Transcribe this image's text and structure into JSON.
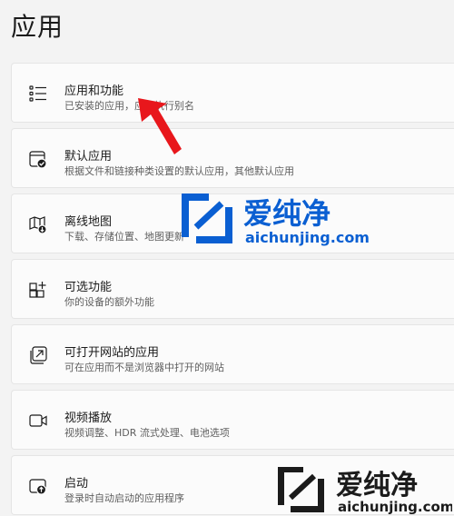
{
  "page": {
    "title": "应用"
  },
  "items": [
    {
      "title": "应用和功能",
      "desc": "已安装的应用，应用执行别名",
      "icon": "apps-list-icon"
    },
    {
      "title": "默认应用",
      "desc": "根据文件和链接种类设置的默认应用，其他默认应用",
      "icon": "default-apps-icon"
    },
    {
      "title": "离线地图",
      "desc": "下载、存储位置、地图更新",
      "icon": "offline-maps-icon"
    },
    {
      "title": "可选功能",
      "desc": "你的设备的额外功能",
      "icon": "optional-features-icon"
    },
    {
      "title": "可打开网站的应用",
      "desc": "可在应用而不是浏览器中打开的网站",
      "icon": "apps-for-websites-icon"
    },
    {
      "title": "视频播放",
      "desc": "视频调整、HDR 流式处理、电池选项",
      "icon": "video-playback-icon"
    },
    {
      "title": "启动",
      "desc": "登录时自动启动的应用程序",
      "icon": "startup-icon"
    }
  ],
  "watermark": {
    "brand": "爱纯净",
    "url": "aichunjing.com"
  },
  "colors": {
    "accent": "#0a5fd2",
    "pointer": "#e8171c"
  }
}
